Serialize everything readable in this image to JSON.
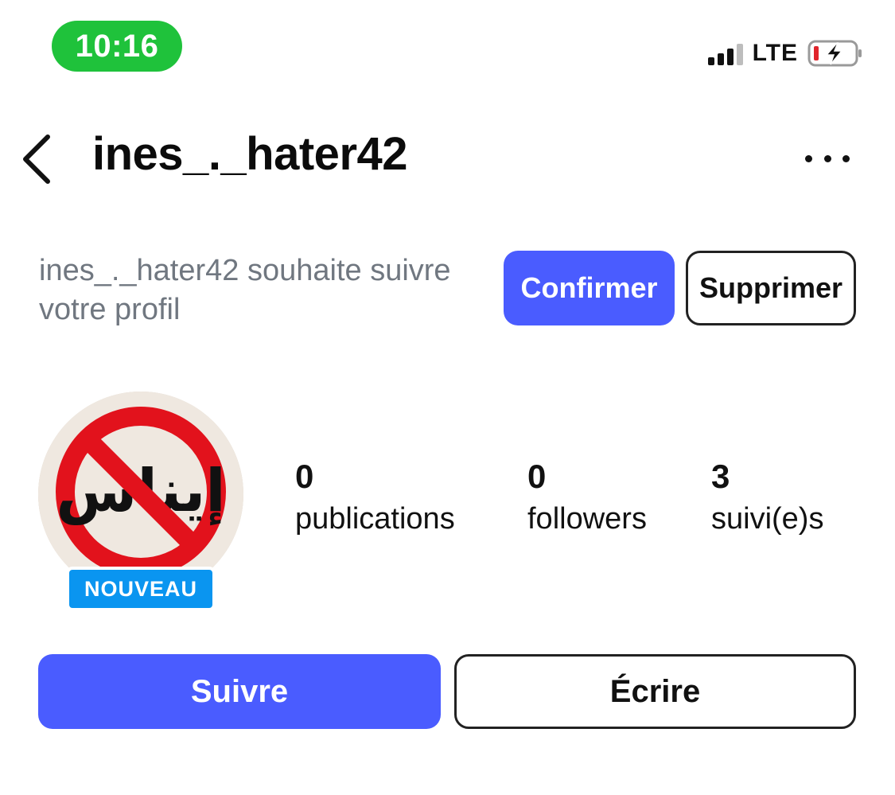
{
  "status_bar": {
    "time": "10:16",
    "network": "LTE",
    "signal_icon": "signal-bars-icon",
    "battery_icon": "battery-charging-icon",
    "time_pill_color": "#1fc23b"
  },
  "header": {
    "back_icon": "chevron-left-icon",
    "username": "ines_._hater42",
    "more_icon": "more-horizontal-icon"
  },
  "follow_request": {
    "text": "ines_._hater42 souhaite suivre votre profil",
    "confirm_label": "Confirmer",
    "delete_label": "Supprimer"
  },
  "profile": {
    "avatar_text": "إيناس",
    "badge": "NOUVEAU",
    "stats": [
      {
        "value": "0",
        "label": "publications"
      },
      {
        "value": "0",
        "label": "followers"
      },
      {
        "value": "3",
        "label": "suivi(e)s"
      }
    ]
  },
  "actions": {
    "follow_label": "Suivre",
    "message_label": "Écrire"
  },
  "colors": {
    "accent": "#4a5cff",
    "badge": "#0a95f0",
    "muted_text": "#707780"
  }
}
